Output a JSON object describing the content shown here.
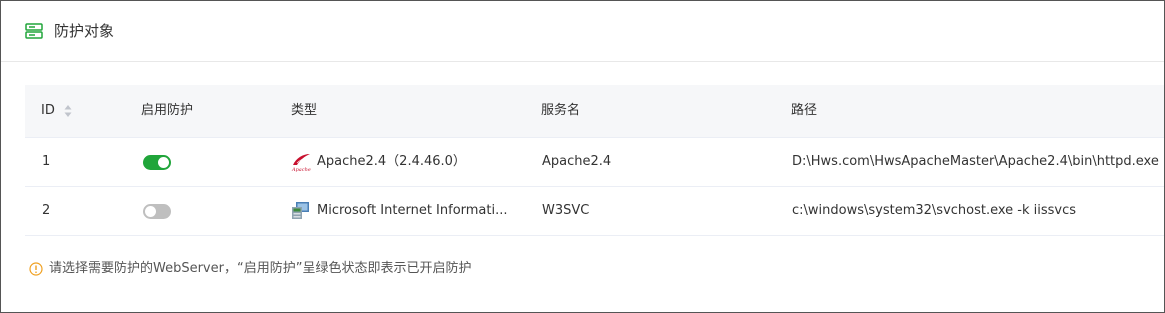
{
  "panel": {
    "title": "防护对象",
    "icon": "server-icon",
    "accent": "#20a53a"
  },
  "table": {
    "columns": [
      "ID",
      "启用防护",
      "类型",
      "服务名",
      "路径"
    ],
    "rows": [
      {
        "id": "1",
        "enabled": true,
        "type_icon": "apache-feather-icon",
        "type": "Apache2.4（2.4.46.0）",
        "service": "Apache2.4",
        "path": "D:\\Hws.com\\HwsApacheMaster\\Apache2.4\\bin\\httpd.exe"
      },
      {
        "id": "2",
        "enabled": false,
        "type_icon": "iis-icon",
        "type": "Microsoft Internet Informati...",
        "service": "W3SVC",
        "path": "c:\\windows\\system32\\svchost.exe -k iissvcs"
      }
    ]
  },
  "notice": {
    "icon": "info-circle-icon",
    "text": "请选择需要防护的WebServer，“启用防护”呈绿色状态即表示已开启防护",
    "color": "#f0a020"
  }
}
